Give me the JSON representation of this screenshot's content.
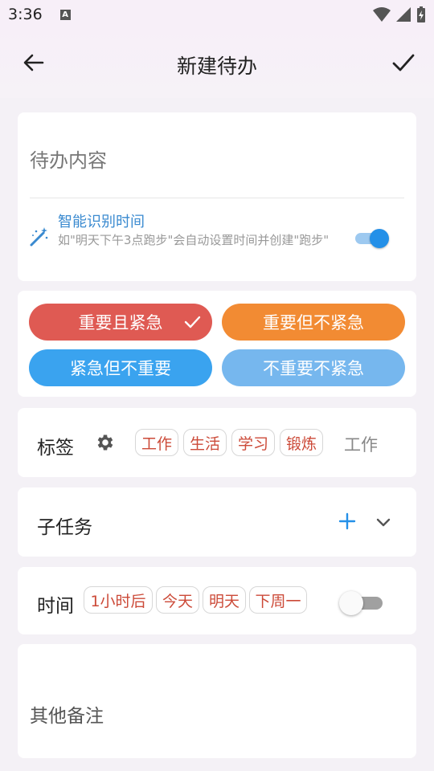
{
  "status_bar": {
    "time": "3:36",
    "notif_letter": "A"
  },
  "app_bar": {
    "title": "新建待办"
  },
  "content": {
    "placeholder": "待办内容",
    "smart_title": "智能识别时间",
    "smart_desc": "如\"明天下午3点跑步\"会自动设置时间并创建\"跑步\"",
    "smart_enabled": true
  },
  "priority": {
    "options": [
      {
        "label": "重要且紧急",
        "color": "#df5a53",
        "selected": true
      },
      {
        "label": "重要但不紧急",
        "color": "#f28b33",
        "selected": false
      },
      {
        "label": "紧急但不重要",
        "color": "#3aa3ef",
        "selected": false
      },
      {
        "label": "不重要不紧急",
        "color": "#76b7ee",
        "selected": false
      }
    ]
  },
  "tags": {
    "label": "标签",
    "chips": [
      "工作",
      "生活",
      "学习",
      "锻炼"
    ],
    "selected_value": "工作"
  },
  "subtasks": {
    "label": "子任务"
  },
  "time": {
    "label": "时间",
    "chips": [
      "1小时后",
      "今天",
      "明天",
      "下周一"
    ],
    "enabled": false
  },
  "notes": {
    "placeholder": "其他备注"
  },
  "colors": {
    "accent": "#2490e8",
    "chip_text": "#cc4a38",
    "smart_title": "#3a8ad0"
  }
}
